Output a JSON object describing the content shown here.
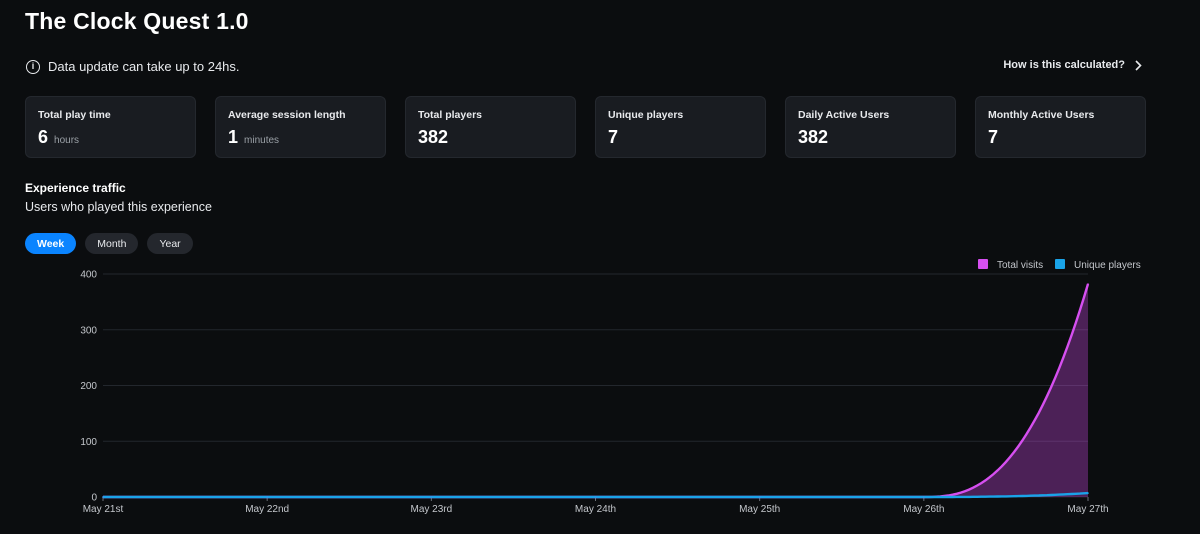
{
  "page": {
    "title": "The Clock Quest 1.0",
    "notice": "Data update can take up to 24hs.",
    "how_link": "How is this calculated?"
  },
  "cards": [
    {
      "label": "Total play time",
      "value": "6",
      "unit": "hours"
    },
    {
      "label": "Average session length",
      "value": "1",
      "unit": "minutes"
    },
    {
      "label": "Total players",
      "value": "382",
      "unit": ""
    },
    {
      "label": "Unique players",
      "value": "7",
      "unit": ""
    },
    {
      "label": "Daily Active Users",
      "value": "382",
      "unit": ""
    },
    {
      "label": "Monthly Active Users",
      "value": "7",
      "unit": ""
    }
  ],
  "traffic": {
    "title": "Experience traffic",
    "subtitle": "Users who played this experience",
    "tabs": [
      "Week",
      "Month",
      "Year"
    ],
    "active_tab": "Week"
  },
  "colors": {
    "accent": "#0a84ff",
    "total_visits": "#d64ff0",
    "unique_players": "#1aa3e8"
  },
  "chart_data": {
    "type": "area",
    "categories": [
      "May 21st",
      "May 22nd",
      "May 23rd",
      "May 24th",
      "May 25th",
      "May 26th",
      "May 27th"
    ],
    "series": [
      {
        "name": "Total visits",
        "values": [
          0,
          0,
          0,
          0,
          0,
          0,
          382
        ]
      },
      {
        "name": "Unique players",
        "values": [
          0,
          0,
          0,
          0,
          0,
          0,
          7
        ]
      }
    ],
    "yticks": [
      0,
      100,
      200,
      300,
      400
    ],
    "ylim": [
      0,
      400
    ],
    "grid": true,
    "legend": "top-right"
  }
}
